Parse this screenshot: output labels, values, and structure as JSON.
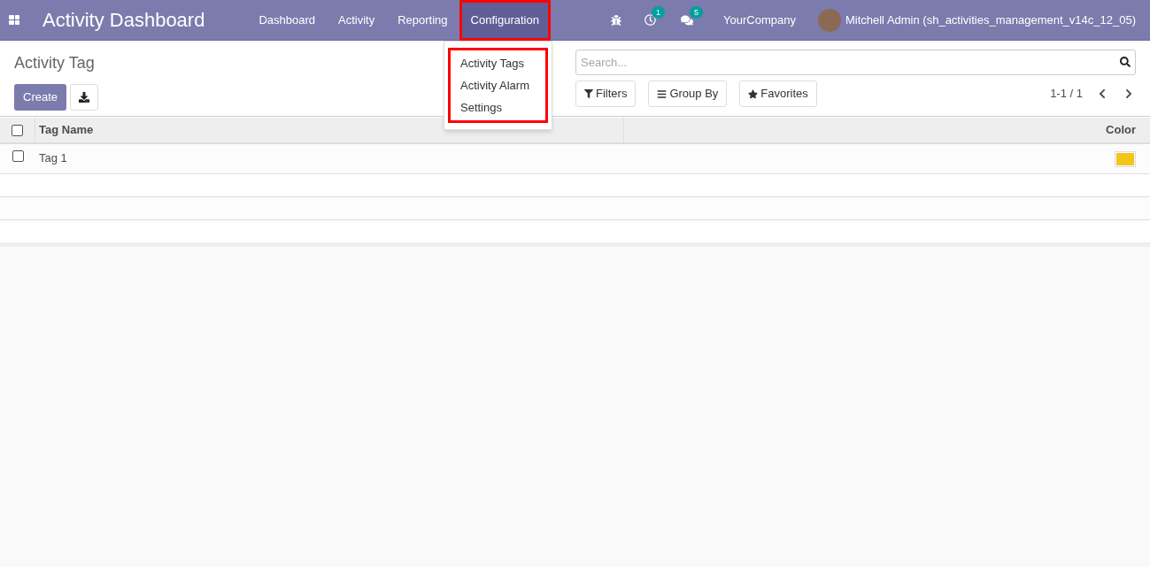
{
  "navbar": {
    "app_title": "Activity Dashboard",
    "menus": [
      {
        "label": "Dashboard",
        "selected": false,
        "highlighted": false
      },
      {
        "label": "Activity",
        "selected": false,
        "highlighted": false
      },
      {
        "label": "Reporting",
        "selected": false,
        "highlighted": false
      },
      {
        "label": "Configuration",
        "selected": true,
        "highlighted": true
      }
    ],
    "activity_count": "1",
    "message_count": "5",
    "company": "YourCompany",
    "user": "Mitchell Admin (sh_activities_management_v14c_12_05)"
  },
  "dropdown": {
    "highlighted": true,
    "items": [
      "Activity Tags",
      "Activity Alarm",
      "Settings"
    ]
  },
  "control_panel": {
    "title": "Activity Tag",
    "create_label": "Create",
    "search": {
      "placeholder": "Search..."
    },
    "filters": "Filters",
    "group_by": "Group By",
    "favorites": "Favorites",
    "pager": "1-1 / 1"
  },
  "table": {
    "columns": [
      "Tag Name",
      "Color"
    ],
    "rows": [
      {
        "name": "Tag 1",
        "color": "#f5c518",
        "checked": false
      }
    ],
    "header_checked": false
  }
}
